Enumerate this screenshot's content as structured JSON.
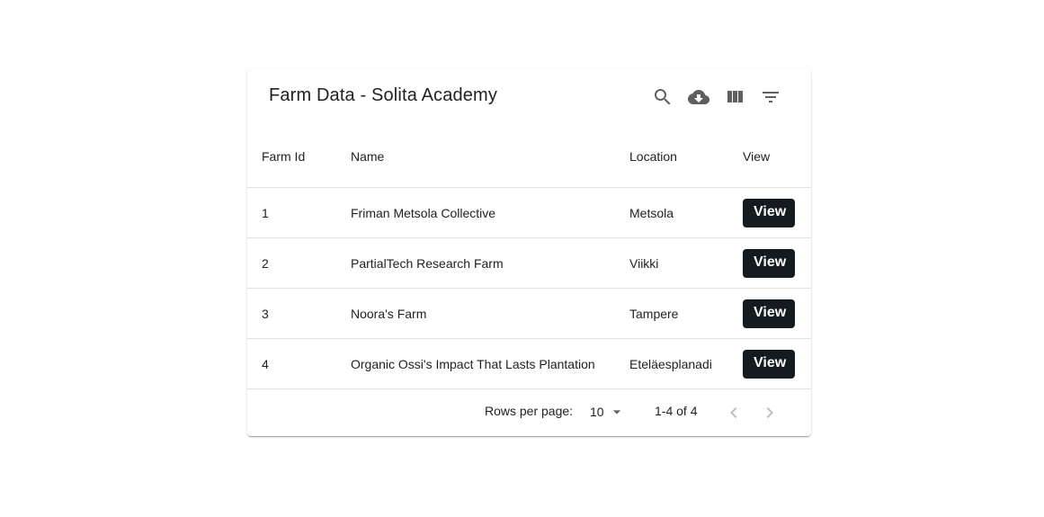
{
  "toolbar": {
    "title": "Farm Data - Solita Academy",
    "icons": [
      "search-icon",
      "cloud-download-icon",
      "view-column-icon",
      "filter-list-icon"
    ]
  },
  "table": {
    "headers": [
      "Farm Id",
      "Name",
      "Location",
      "View"
    ],
    "rows": [
      {
        "id": "1",
        "name": "Friman Metsola Collective",
        "location": "Metsola",
        "action": "View"
      },
      {
        "id": "2",
        "name": "PartialTech Research Farm",
        "location": "Viikki",
        "action": "View"
      },
      {
        "id": "3",
        "name": "Noora's Farm",
        "location": "Tampere",
        "action": "View"
      },
      {
        "id": "4",
        "name": "Organic Ossi's Impact That Lasts Plantation",
        "location": "Eteläesplanadi",
        "action": "View"
      }
    ]
  },
  "pagination": {
    "rows_per_page_label": "Rows per page:",
    "rows_per_page_value": "10",
    "range": "1-4 of 4"
  },
  "colors": {
    "button_bg": "#141b1f",
    "button_text": "#ffffff",
    "divider": "#e0e0e0"
  }
}
